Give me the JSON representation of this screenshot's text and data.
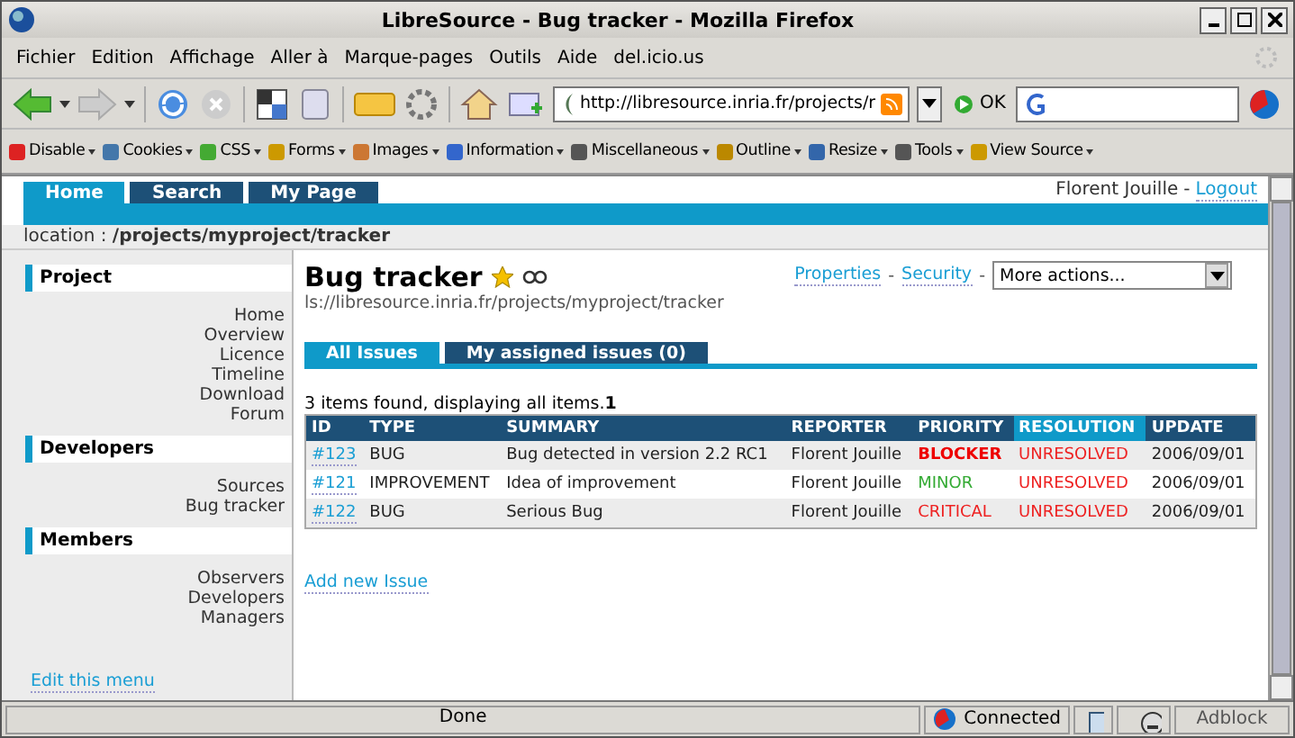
{
  "window": {
    "title": "LibreSource - Bug tracker - Mozilla Firefox"
  },
  "menu": [
    "Fichier",
    "Edition",
    "Affichage",
    "Aller à",
    "Marque-pages",
    "Outils",
    "Aide",
    "del.icio.us"
  ],
  "address": {
    "value": "http://libresource.inria.fr/projects/r",
    "go": "OK"
  },
  "devbar": [
    "Disable",
    "Cookies",
    "CSS",
    "Forms",
    "Images",
    "Information",
    "Miscellaneous",
    "Outline",
    "Resize",
    "Tools",
    "View Source"
  ],
  "site_tabs": [
    {
      "label": "Home",
      "selected": true
    },
    {
      "label": "Search",
      "selected": false
    },
    {
      "label": "My Page",
      "selected": false
    }
  ],
  "user": {
    "name": "Florent Jouille",
    "separator": "-",
    "logout": "Logout"
  },
  "location": {
    "label": "location :",
    "path": "/projects/myproject/tracker"
  },
  "sidebar": {
    "sections": [
      {
        "title": "Project",
        "items": [
          "Home",
          "Overview",
          "Licence",
          "Timeline",
          "Download",
          "Forum"
        ]
      },
      {
        "title": "Developers",
        "items": [
          "Sources",
          "Bug tracker"
        ]
      },
      {
        "title": "Members",
        "items": [
          "Observers",
          "Developers",
          "Managers"
        ]
      }
    ],
    "edit": "Edit this menu"
  },
  "page": {
    "title": "Bug tracker",
    "uri": "ls://libresource.inria.fr/projects/myproject/tracker",
    "links": [
      "Properties",
      "Security"
    ],
    "separator": "-",
    "actions": "More actions..."
  },
  "issue_tabs": [
    {
      "label": "All Issues",
      "selected": true
    },
    {
      "label": "My assigned issues (0)",
      "selected": false
    }
  ],
  "found": "3 items found, displaying all items.**1**",
  "table": {
    "columns": [
      {
        "label": "ID",
        "selected": false
      },
      {
        "label": "TYPE",
        "selected": false
      },
      {
        "label": "SUMMARY",
        "selected": false
      },
      {
        "label": "REPORTER",
        "selected": false
      },
      {
        "label": "PRIORITY",
        "selected": false
      },
      {
        "label": "RESOLUTION",
        "selected": true
      },
      {
        "label": "UPDATE",
        "selected": false
      }
    ],
    "rows": [
      {
        "id": "#123",
        "type": "BUG",
        "summary": "Bug detected in version 2.2 RC1",
        "reporter": "Florent Jouille",
        "priority": {
          "text": "BLOCKER",
          "kind": "blocker"
        },
        "resolution": "UNRESOLVED",
        "update": "2006/09/01"
      },
      {
        "id": "#121",
        "type": "IMPROVEMENT",
        "summary": "Idea of improvement",
        "reporter": "Florent Jouille",
        "priority": {
          "text": "MINOR",
          "kind": "minor"
        },
        "resolution": "UNRESOLVED",
        "update": "2006/09/01"
      },
      {
        "id": "#122",
        "type": "BUG",
        "summary": "Serious Bug",
        "reporter": "Florent Jouille",
        "priority": {
          "text": "CRITICAL",
          "kind": "critical"
        },
        "resolution": "UNRESOLVED",
        "update": "2006/09/01"
      }
    ]
  },
  "add_issue": "Add new Issue",
  "status_bar": {
    "text": "Done",
    "connection": "Connected",
    "adblock": "Adblock"
  }
}
